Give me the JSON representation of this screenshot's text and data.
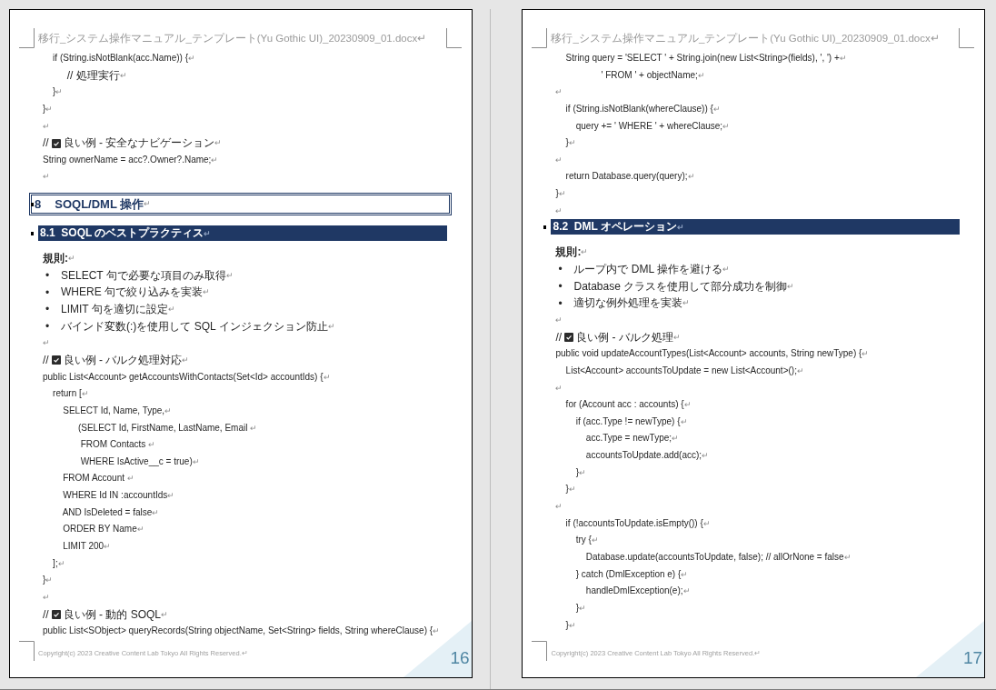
{
  "pages": [
    {
      "header": "移行_システム操作マニュアル_テンプレート(Yu Gothic UI)_20230909_01.docx↵",
      "lines": [
        {
          "kind": "code",
          "text": "    if (String.isNotBlank(acc.Name)) {",
          "end": "↵"
        },
        {
          "kind": "code",
          "text": "        // 処理実行",
          "end": "↵"
        },
        {
          "kind": "code",
          "text": "    }",
          "end": "↵"
        },
        {
          "kind": "code",
          "text": "}",
          "end": "↵"
        },
        {
          "kind": "blank",
          "end": "↵"
        },
        {
          "kind": "check_comment",
          "prefix": "//",
          "text": "良い例 - 安全なナビゲーション",
          "end": "↵"
        },
        {
          "kind": "code",
          "text": "String ownerName = acc?.Owner?.Name;",
          "end": "↵"
        },
        {
          "kind": "blank",
          "end": "↵"
        },
        {
          "kind": "heading1",
          "number": "8",
          "text": "SOQL/DML 操作",
          "end": "↵"
        },
        {
          "kind": "heading2",
          "number": "8.1",
          "text": "SOQL のベストプラクティス",
          "end": "↵"
        },
        {
          "kind": "label",
          "text": "規則:",
          "end": "↵"
        },
        {
          "kind": "bullet",
          "bullet": "•",
          "text": "SELECT 句で必要な項目のみ取得",
          "end": "↵"
        },
        {
          "kind": "bullet",
          "bullet": "•",
          "text": "WHERE 句で絞り込みを実装",
          "end": "↵"
        },
        {
          "kind": "bullet",
          "bullet": "•",
          "text": "LIMIT 句を適切に設定",
          "end": "↵"
        },
        {
          "kind": "bullet",
          "bullet": "•",
          "text": "バインド変数(:)を使用して SQL インジェクション防止",
          "end": "↵"
        },
        {
          "kind": "blank",
          "end": "↵"
        },
        {
          "kind": "check_comment",
          "prefix": "//",
          "text": "良い例 - バルク処理対応",
          "end": "↵"
        },
        {
          "kind": "code",
          "text": "public List<Account> getAccountsWithContacts(Set<Id> accountIds) {",
          "end": "↵"
        },
        {
          "kind": "code",
          "text": "    return [",
          "end": "↵"
        },
        {
          "kind": "code",
          "text": "        SELECT Id, Name, Type,",
          "end": "↵"
        },
        {
          "kind": "code",
          "text": "              (SELECT Id, FirstName, LastName, Email ",
          "end": "↵"
        },
        {
          "kind": "code",
          "text": "               FROM Contacts ",
          "end": "↵"
        },
        {
          "kind": "code",
          "text": "               WHERE IsActive__c = true)",
          "end": "↵"
        },
        {
          "kind": "code",
          "text": "        FROM Account ",
          "end": "↵"
        },
        {
          "kind": "code",
          "text": "        WHERE Id IN :accountIds",
          "end": "↵"
        },
        {
          "kind": "code",
          "text": "        AND IsDeleted = false",
          "end": "↵"
        },
        {
          "kind": "code",
          "text": "        ORDER BY Name",
          "end": "↵"
        },
        {
          "kind": "code",
          "text": "        LIMIT 200",
          "end": "↵"
        },
        {
          "kind": "code",
          "text": "    ];",
          "end": "↵"
        },
        {
          "kind": "code",
          "text": "}",
          "end": "↵"
        },
        {
          "kind": "blank",
          "end": "↵"
        },
        {
          "kind": "check_comment",
          "prefix": "//",
          "text": "良い例 - 動的 SOQL",
          "end": "↵"
        },
        {
          "kind": "code",
          "text": "public List<SObject> queryRecords(String objectName, Set<String> fields, String whereClause) {",
          "end": "↵"
        }
      ],
      "footer": "Copyright(c) 2023 Creative Content Lab Tokyo All Rights Reserved.↵",
      "page_number": "16"
    },
    {
      "header": "移行_システム操作マニュアル_テンプレート(Yu Gothic UI)_20230909_01.docx↵",
      "lines": [
        {
          "kind": "code",
          "text": "    String query = 'SELECT ' + String.join(new List<String>(fields), ', ') +",
          "end": "↵"
        },
        {
          "kind": "code",
          "text": "                  ' FROM ' + objectName;",
          "end": "↵"
        },
        {
          "kind": "blank",
          "end": "↵"
        },
        {
          "kind": "code",
          "text": "    if (String.isNotBlank(whereClause)) {",
          "end": "↵"
        },
        {
          "kind": "code",
          "text": "        query += ' WHERE ' + whereClause;",
          "end": "↵"
        },
        {
          "kind": "code",
          "text": "    }",
          "end": "↵"
        },
        {
          "kind": "blank",
          "end": "↵"
        },
        {
          "kind": "code",
          "text": "    return Database.query(query);",
          "end": "↵"
        },
        {
          "kind": "code",
          "text": "}",
          "end": "↵"
        },
        {
          "kind": "blank",
          "end": "↵"
        },
        {
          "kind": "heading2",
          "number": "8.2",
          "text": "DML オペレーション",
          "end": "↵"
        },
        {
          "kind": "label",
          "text": "規則:",
          "end": "↵"
        },
        {
          "kind": "bullet",
          "bullet": "•",
          "text": "ループ内で DML 操作を避ける",
          "end": "↵"
        },
        {
          "kind": "bullet",
          "bullet": "•",
          "text": "Database クラスを使用して部分成功を制御",
          "end": "↵"
        },
        {
          "kind": "bullet",
          "bullet": "•",
          "text": "適切な例外処理を実装",
          "end": "↵"
        },
        {
          "kind": "blank",
          "end": "↵"
        },
        {
          "kind": "check_comment",
          "prefix": "//",
          "text": "良い例 - バルク処理",
          "end": "↵"
        },
        {
          "kind": "code",
          "text": "public void updateAccountTypes(List<Account> accounts, String newType) {",
          "end": "↵"
        },
        {
          "kind": "code",
          "text": "    List<Account> accountsToUpdate = new List<Account>();",
          "end": "↵"
        },
        {
          "kind": "blank",
          "end": "↵"
        },
        {
          "kind": "code",
          "text": "    for (Account acc : accounts) {",
          "end": "↵"
        },
        {
          "kind": "code",
          "text": "        if (acc.Type != newType) {",
          "end": "↵"
        },
        {
          "kind": "code",
          "text": "            acc.Type = newType;",
          "end": "↵"
        },
        {
          "kind": "code",
          "text": "            accountsToUpdate.add(acc);",
          "end": "↵"
        },
        {
          "kind": "code",
          "text": "        }",
          "end": "↵"
        },
        {
          "kind": "code",
          "text": "    }",
          "end": "↵"
        },
        {
          "kind": "blank",
          "end": "↵"
        },
        {
          "kind": "code",
          "text": "    if (!accountsToUpdate.isEmpty()) {",
          "end": "↵"
        },
        {
          "kind": "code",
          "text": "        try {",
          "end": "↵"
        },
        {
          "kind": "code",
          "text": "            Database.update(accountsToUpdate, false); // allOrNone = false",
          "end": "↵"
        },
        {
          "kind": "code",
          "text": "        } catch (DmlException e) {",
          "end": "↵"
        },
        {
          "kind": "code",
          "text": "            handleDmlException(e);",
          "end": "↵"
        },
        {
          "kind": "code",
          "text": "        }",
          "end": "↵"
        },
        {
          "kind": "code",
          "text": "    }",
          "end": "↵"
        }
      ],
      "footer": "Copyright(c) 2023 Creative Content Lab Tokyo All Rights Reserved.↵",
      "page_number": "17"
    }
  ]
}
